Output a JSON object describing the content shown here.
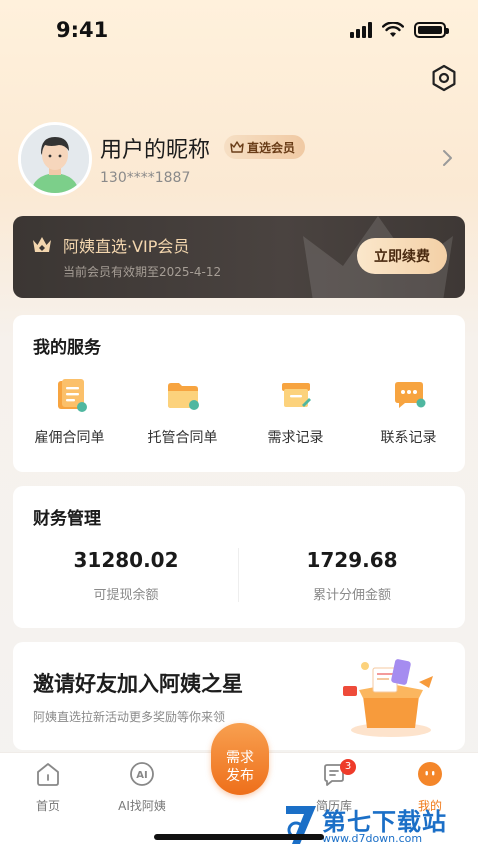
{
  "status_bar": {
    "time": "9:41"
  },
  "profile": {
    "nickname": "用户的昵称",
    "vip_badge": "直选会员",
    "phone": "130****1887"
  },
  "vip_card": {
    "title": "阿姨直选·VIP会员",
    "expiry": "当前会员有效期至2025-4-12",
    "renew_label": "立即续费"
  },
  "services": {
    "title": "我的服务",
    "items": [
      {
        "label": "雇佣合同单",
        "icon": "contract-icon"
      },
      {
        "label": "托管合同单",
        "icon": "folder-icon"
      },
      {
        "label": "需求记录",
        "icon": "demand-box-icon"
      },
      {
        "label": "联系记录",
        "icon": "chat-icon"
      }
    ]
  },
  "finance": {
    "title": "财务管理",
    "withdrawable": {
      "value": "31280.02",
      "label": "可提现余额"
    },
    "commission": {
      "value": "1729.68",
      "label": "累计分佣金额"
    }
  },
  "invite": {
    "title": "邀请好友加入阿姨之星",
    "subtitle": "阿姨直选拉新活动更多奖励等你来领"
  },
  "tabbar": {
    "tabs": [
      {
        "label": "首页",
        "icon": "home-icon"
      },
      {
        "label": "AI找阿姨",
        "icon": "ai-icon"
      },
      {
        "label": "需求\n发布",
        "icon": "publish-button"
      },
      {
        "label": "简历库",
        "icon": "resume-icon",
        "badge": "3"
      },
      {
        "label": "我的",
        "icon": "me-icon",
        "active": true
      }
    ],
    "publish_line1": "需求",
    "publish_line2": "发布"
  },
  "watermark": {
    "title": "第七下载站",
    "url": "www.d7down.com"
  },
  "colors": {
    "accent": "#f07a1a",
    "vip_dark": "#3b3633",
    "vip_gold": "#f3d6ae"
  }
}
